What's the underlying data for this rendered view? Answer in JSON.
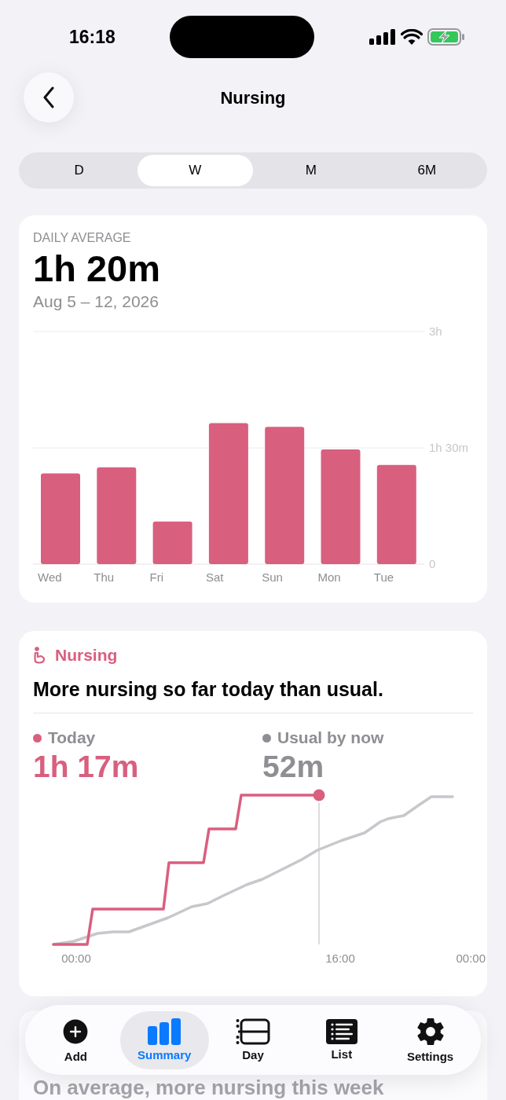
{
  "status_bar": {
    "time": "16:18"
  },
  "header": {
    "title": "Nursing"
  },
  "segments": [
    {
      "label": "D",
      "selected": false
    },
    {
      "label": "W",
      "selected": true
    },
    {
      "label": "M",
      "selected": false
    },
    {
      "label": "6M",
      "selected": false
    }
  ],
  "summary_card": {
    "caption": "DAILY AVERAGE",
    "value": "1h 20m",
    "date_range": "Aug 5 – 12, 2026",
    "chart_data": {
      "type": "bar",
      "categories": [
        "Wed",
        "Thu",
        "Fri",
        "Sat",
        "Sun",
        "Mon",
        "Tue"
      ],
      "series": [
        {
          "color": "#d95f7f",
          "values": [
            1.17,
            1.25,
            0.55,
            1.82,
            1.77,
            1.48,
            1.28
          ]
        }
      ],
      "ylim": [
        0,
        3
      ],
      "yticks": [
        {
          "value": 0,
          "label": "0"
        },
        {
          "value": 1.5,
          "label": "1h 30m"
        },
        {
          "value": 3,
          "label": "3h"
        }
      ]
    }
  },
  "insight_card": {
    "category": "Nursing",
    "headline": "More nursing so far today than usual.",
    "stats": [
      {
        "label": "Today",
        "value": "1h 17m",
        "color": "#d95f7f"
      },
      {
        "label": "Usual by now",
        "value": "52m",
        "color": "#8e8e93"
      }
    ],
    "axis_labels": [
      "00:00",
      "16:00",
      "00:00"
    ]
  },
  "next_card": {
    "headline": "On average, more nursing this week"
  },
  "tab_bar": [
    {
      "label": "Add",
      "kind": "add",
      "selected": false
    },
    {
      "label": "Summary",
      "kind": "summary",
      "selected": true
    },
    {
      "label": "Day",
      "kind": "day",
      "selected": false
    },
    {
      "label": "List",
      "kind": "list",
      "selected": false
    },
    {
      "label": "Settings",
      "kind": "settings",
      "selected": false
    }
  ]
}
